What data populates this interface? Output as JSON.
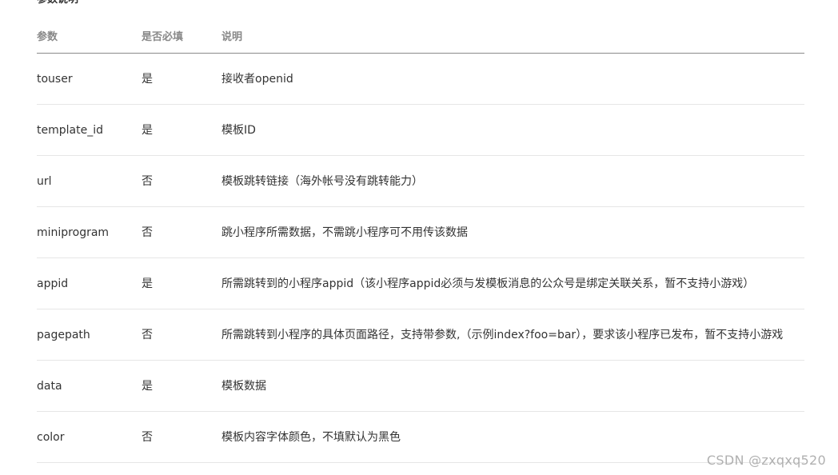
{
  "section_title": "参数说明",
  "table": {
    "headers": {
      "param": "参数",
      "required": "是否必填",
      "description": "说明"
    },
    "rows": [
      {
        "param": "touser",
        "required": "是",
        "description": "接收者openid"
      },
      {
        "param": "template_id",
        "required": "是",
        "description": "模板ID"
      },
      {
        "param": "url",
        "required": "否",
        "description": "模板跳转链接（海外帐号没有跳转能力）"
      },
      {
        "param": "miniprogram",
        "required": "否",
        "description": "跳小程序所需数据，不需跳小程序可不用传该数据"
      },
      {
        "param": "appid",
        "required": "是",
        "description": "所需跳转到的小程序appid（该小程序appid必须与发模板消息的公众号是绑定关联关系，暂不支持小游戏）"
      },
      {
        "param": "pagepath",
        "required": "否",
        "description": "所需跳转到小程序的具体页面路径，支持带参数,（示例index?foo=bar），要求该小程序已发布，暂不支持小游戏"
      },
      {
        "param": "data",
        "required": "是",
        "description": "模板数据"
      },
      {
        "param": "color",
        "required": "否",
        "description": "模板内容字体颜色，不填默认为黑色"
      }
    ]
  },
  "watermark": "CSDN @zxqxq520"
}
